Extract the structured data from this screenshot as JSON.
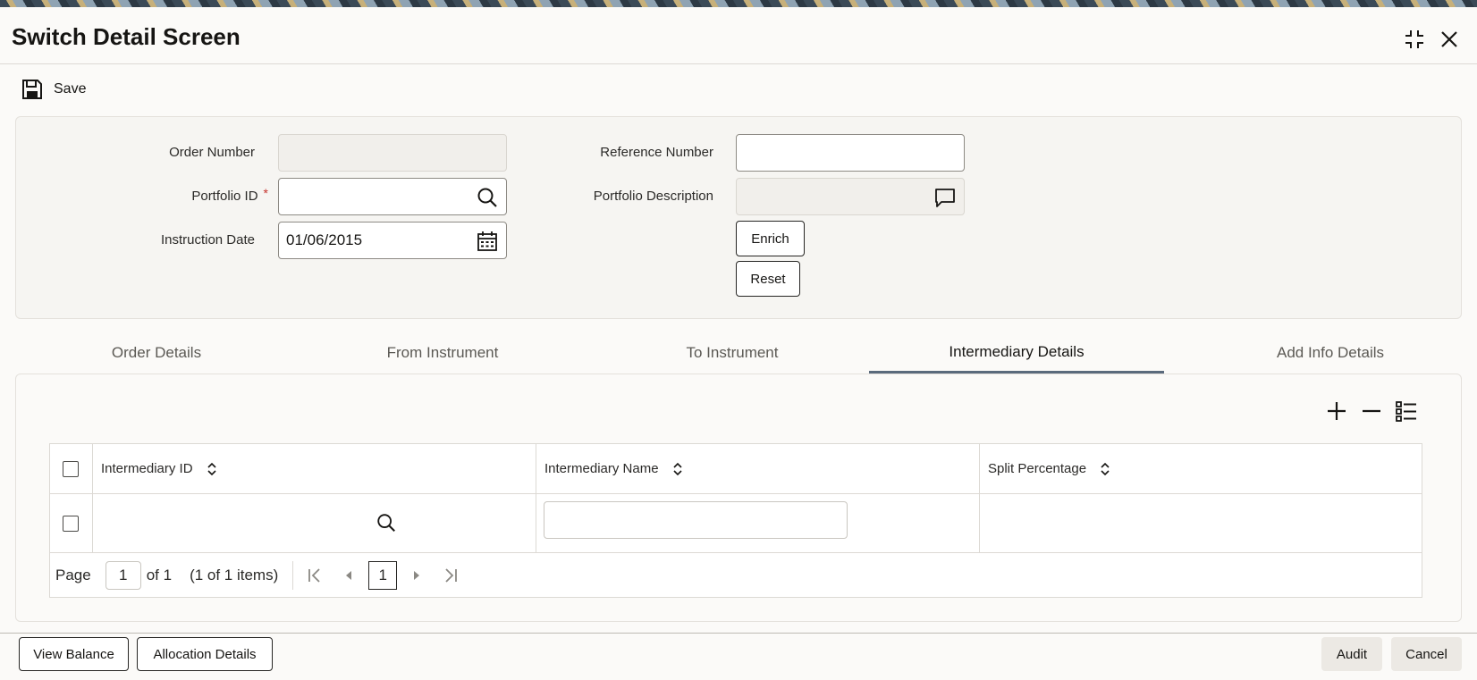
{
  "window": {
    "title": "Switch Detail Screen"
  },
  "toolbar": {
    "save_label": "Save"
  },
  "form": {
    "order_number": {
      "label": "Order Number",
      "value": ""
    },
    "portfolio_id": {
      "label": "Portfolio ID",
      "required_mark": "*",
      "value": ""
    },
    "instruction_date": {
      "label": "Instruction Date",
      "value": "01/06/2015"
    },
    "reference_number": {
      "label": "Reference Number",
      "value": ""
    },
    "portfolio_description": {
      "label": "Portfolio Description",
      "value": ""
    },
    "enrich_label": "Enrich",
    "reset_label": "Reset"
  },
  "tabs": [
    {
      "label": "Order Details",
      "active": false
    },
    {
      "label": "From Instrument",
      "active": false
    },
    {
      "label": "To Instrument",
      "active": false
    },
    {
      "label": "Intermediary Details",
      "active": true
    },
    {
      "label": "Add Info Details",
      "active": false
    }
  ],
  "grid": {
    "columns": [
      "Intermediary ID",
      "Intermediary Name",
      "Split Percentage"
    ],
    "rows": [
      {
        "intermediary_id": "",
        "intermediary_name": "",
        "split_percentage": ""
      }
    ],
    "pager": {
      "page_label": "Page",
      "page_value": "1",
      "of_label": "of 1",
      "items_label": "(1 of 1 items)",
      "current_page": "1"
    }
  },
  "footer": {
    "view_balance_label": "View Balance",
    "allocation_details_label": "Allocation Details",
    "audit_label": "Audit",
    "cancel_label": "Cancel"
  },
  "colors": {
    "accent_tab_underline": "#5a6a7c",
    "required": "#c5312b",
    "text": "#161513"
  }
}
